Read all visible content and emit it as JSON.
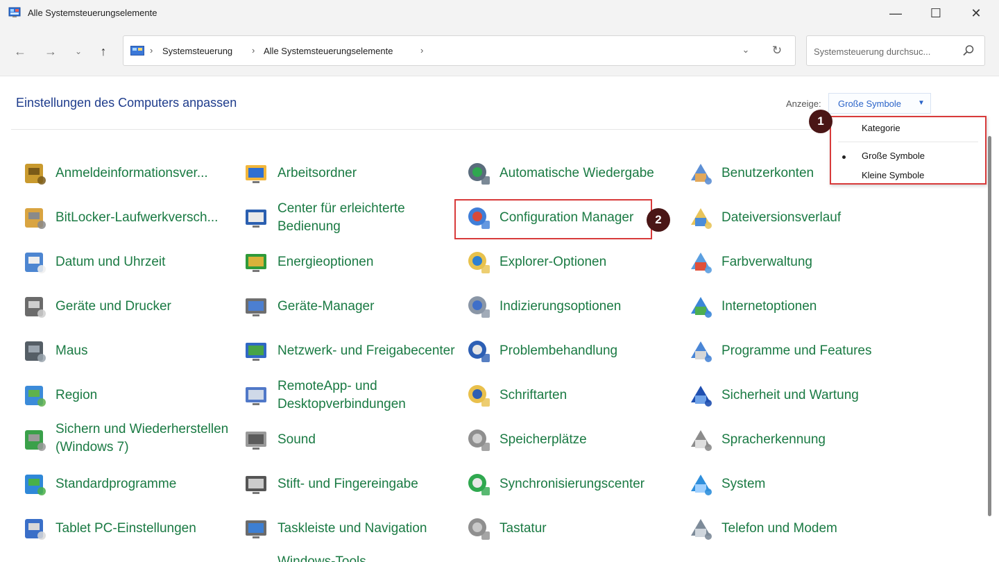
{
  "window": {
    "title": "Alle Systemsteuerungselemente",
    "minimize": "—",
    "maximize": "☐",
    "close": "✕"
  },
  "nav": {
    "back": "←",
    "forward": "→",
    "recent": "⌄",
    "up": "↑",
    "breadcrumb": [
      "Systemsteuerung",
      "Alle Systemsteuerungselemente"
    ],
    "separator": "›",
    "dropdown": "⌄",
    "refresh": "↻"
  },
  "search": {
    "placeholder": "Systemsteuerung durchsuc..."
  },
  "header": {
    "title": "Einstellungen des Computers anpassen",
    "view_label": "Anzeige:",
    "view_value": "Große Symbole",
    "caret": "▼"
  },
  "view_menu": {
    "items": [
      "Kategorie",
      "Große Symbole",
      "Kleine Symbole"
    ],
    "selected": "Große Symbole"
  },
  "badges": [
    "1",
    "2"
  ],
  "items": [
    [
      "Anmeldeinformationsver...",
      "Arbeitsordner",
      "Automatische Wiedergabe",
      "Benutzerkonten"
    ],
    [
      "BitLocker-Laufwerkversch...",
      "Center für erleichterte Bedienung",
      "Configuration Manager",
      "Dateiversionsverlauf"
    ],
    [
      "Datum und Uhrzeit",
      "Energieoptionen",
      "Explorer-Optionen",
      "Farbverwaltung"
    ],
    [
      "Geräte und Drucker",
      "Geräte-Manager",
      "Indizierungsoptionen",
      "Internetoptionen"
    ],
    [
      "Maus",
      "Netzwerk- und Freigabecenter",
      "Problembehandlung",
      "Programme und Features"
    ],
    [
      "Region",
      "RemoteApp- und Desktopverbindungen",
      "Schriftarten",
      "Sicherheit und Wartung"
    ],
    [
      "Sichern und Wiederherstellen (Windows 7)",
      "Sound",
      "Speicherplätze",
      "Spracherkennung"
    ],
    [
      "Standardprogramme",
      "Stift- und Fingereingabe",
      "Synchronisierungscenter",
      "System"
    ],
    [
      "Tablet PC-Einstellungen",
      "Taskleiste und Navigation",
      "Tastatur",
      "Telefon und Modem"
    ]
  ],
  "icons": [
    [
      "credential-manager-icon",
      "work-folders-icon",
      "autoplay-icon",
      "user-accounts-icon"
    ],
    [
      "bitlocker-icon",
      "ease-of-access-icon",
      "configuration-manager-icon",
      "file-history-icon"
    ],
    [
      "date-time-icon",
      "power-options-icon",
      "explorer-options-icon",
      "color-management-icon"
    ],
    [
      "devices-printers-icon",
      "device-manager-icon",
      "indexing-options-icon",
      "internet-options-icon"
    ],
    [
      "mouse-icon",
      "network-sharing-icon",
      "troubleshooting-icon",
      "programs-features-icon"
    ],
    [
      "region-icon",
      "remoteapp-icon",
      "fonts-icon",
      "security-maintenance-icon"
    ],
    [
      "backup-restore-icon",
      "sound-icon",
      "storage-spaces-icon",
      "speech-recognition-icon"
    ],
    [
      "default-programs-icon",
      "pen-touch-icon",
      "sync-center-icon",
      "system-icon"
    ],
    [
      "tablet-pc-icon",
      "taskbar-navigation-icon",
      "keyboard-icon",
      "phone-modem-icon"
    ]
  ],
  "partial_next_row": "Windows-Tools",
  "colors": {
    "link_green": "#1a7a43",
    "title_blue": "#1e3c8c",
    "highlight_red": "#d83a3a",
    "badge": "#4a1616",
    "accent_blue": "#2a63c8"
  }
}
